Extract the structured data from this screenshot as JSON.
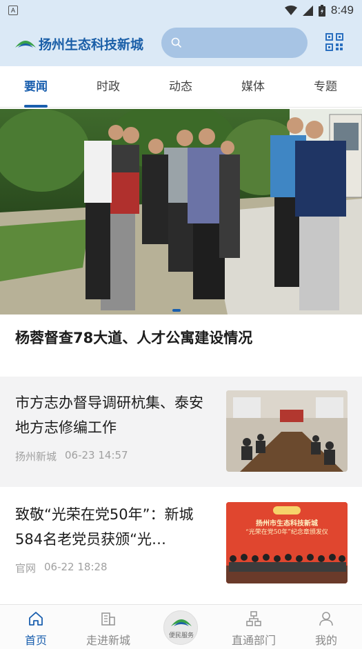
{
  "status_bar": {
    "left_icon": "A",
    "time": "8:49"
  },
  "header": {
    "logo_text": "扬州生态科技新城",
    "search_placeholder": ""
  },
  "tabs": [
    {
      "label": "要闻",
      "active": true
    },
    {
      "label": "时政",
      "active": false
    },
    {
      "label": "动态",
      "active": false
    },
    {
      "label": "媒体",
      "active": false
    },
    {
      "label": "专题",
      "active": false
    }
  ],
  "hero": {
    "title": "杨蓉督查78大道、人才公寓建设情况"
  },
  "news": [
    {
      "title": "市方志办督导调研杭集、泰安地方志修编工作",
      "source": "扬州新城",
      "time": "06-23 14:57"
    },
    {
      "title": "致敬“光荣在党50年”：新城584名老党员获颁“光…",
      "source": "官网",
      "time": "06-22 18:28",
      "thumb_banner_line1": "扬州市生态科技新城",
      "thumb_banner_line2": "“光荣在党50年”纪念章颁发仪"
    }
  ],
  "bottom_nav": {
    "items": [
      {
        "label": "首页",
        "icon": "home-icon",
        "active": true
      },
      {
        "label": "走进新城",
        "icon": "building-icon",
        "active": false
      },
      {
        "label": "便民服务",
        "icon": "service-logo-icon",
        "active": false
      },
      {
        "label": "直通部门",
        "icon": "org-chart-icon",
        "active": false
      },
      {
        "label": "我的",
        "icon": "person-icon",
        "active": false
      }
    ]
  },
  "colors": {
    "accent": "#1a5fae",
    "header_bg": "#dbe9f6",
    "search_bg": "#a7c4e4"
  }
}
